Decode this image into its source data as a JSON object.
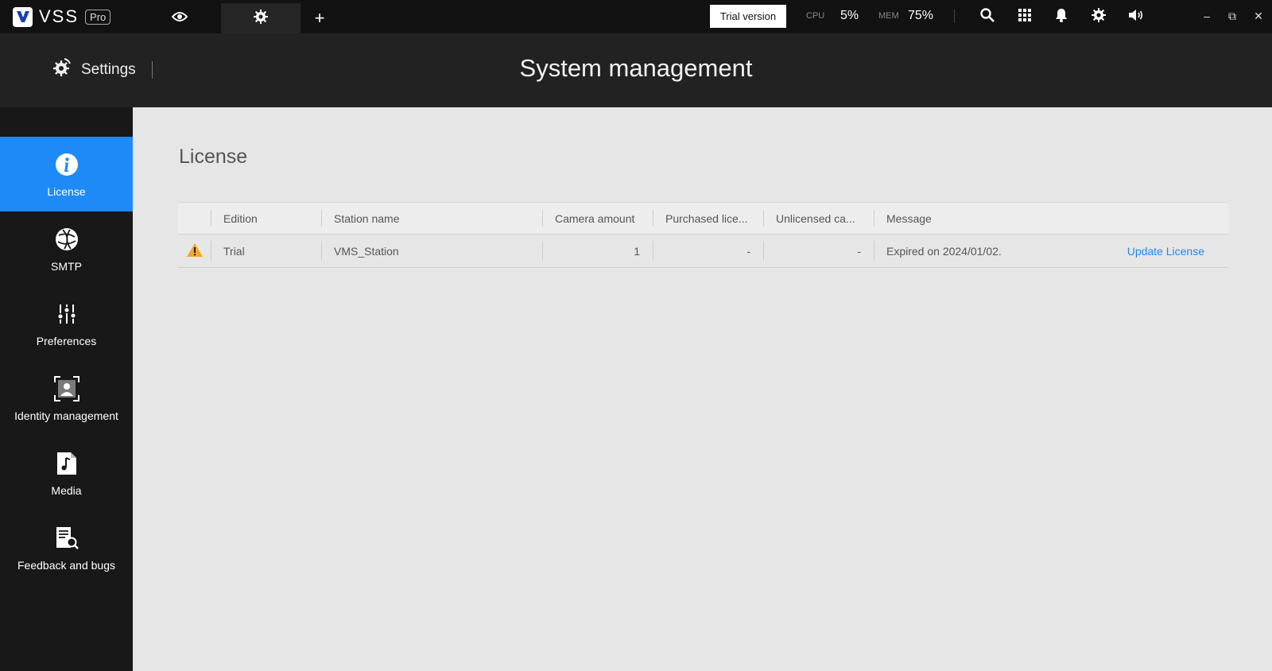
{
  "app": {
    "name": "VSS",
    "badge": "Pro"
  },
  "topbar": {
    "plus_label": "+",
    "trial_label": "Trial version",
    "cpu_label": "CPU",
    "cpu_value": "5%",
    "mem_label": "MEM",
    "mem_value": "75%",
    "icons": [
      "eye-icon",
      "gear-icon",
      "search-icon",
      "grid-icon",
      "bell-icon",
      "settings-icon",
      "speaker-icon"
    ],
    "window_controls": {
      "minimize": "–",
      "restore": "⧉",
      "close": "✕"
    }
  },
  "header": {
    "crumb": "Settings",
    "title": "System management"
  },
  "sidebar": {
    "items": [
      {
        "label": "License",
        "icon": "info-icon",
        "active": true
      },
      {
        "label": "SMTP",
        "icon": "globe-icon",
        "active": false
      },
      {
        "label": "Preferences",
        "icon": "sliders-icon",
        "active": false
      },
      {
        "label": "Identity management",
        "icon": "identity-icon",
        "active": false
      },
      {
        "label": "Media",
        "icon": "media-file-icon",
        "active": false
      },
      {
        "label": "Feedback and bugs",
        "icon": "feedback-icon",
        "active": false
      }
    ]
  },
  "main": {
    "section_title": "License",
    "table": {
      "headers": [
        "",
        "Edition",
        "Station name",
        "Camera amount",
        "Purchased lice...",
        "Unlicensed ca...",
        "Message"
      ],
      "rows": [
        {
          "status_icon": "warning-icon",
          "edition": "Trial",
          "station_name": "VMS_Station",
          "camera_amount": "1",
          "purchased": "-",
          "unlicensed": "-",
          "message": "Expired on 2024/01/02.",
          "action": "Update License"
        }
      ]
    }
  },
  "colors": {
    "accent": "#1e8af7",
    "warning": "#f5a623"
  }
}
